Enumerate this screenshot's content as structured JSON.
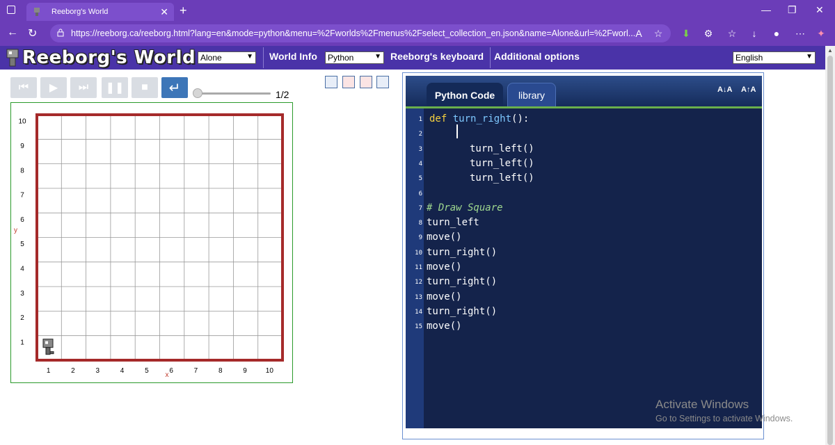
{
  "browser": {
    "tab_title": "Reeborg's World",
    "url": "https://reeborg.ca/reeborg.html?lang=en&mode=python&menu=%2Fworlds%2Fmenus%2Fselect_collection_en.json&name=Alone&url=%2Fworl..."
  },
  "header": {
    "logo_text": "Reeborg's World",
    "world_select": "Alone",
    "world_info": "World Info",
    "mode_select": "Python",
    "keyboard": "Reeborg's keyboard",
    "additional_options": "Additional options",
    "language_select": "English"
  },
  "controls": {
    "step_counter": "1/2"
  },
  "world": {
    "y_ticks": [
      "10",
      "9",
      "8",
      "7",
      "6",
      "5",
      "4",
      "3",
      "2",
      "1"
    ],
    "x_ticks": [
      "1",
      "2",
      "3",
      "4",
      "5",
      "6",
      "7",
      "8",
      "9",
      "10"
    ],
    "x_axis_label": "x",
    "y_axis_label": "y",
    "robot_position": {
      "x": 1,
      "y": 1
    },
    "wall_color": "#a52a2a",
    "border_color": "#2a9a2a"
  },
  "editor": {
    "tab_active": "Python Code",
    "tab_inactive": "library",
    "font_smaller": "A↓A",
    "font_larger": "A↑A",
    "lines": [
      {
        "n": "1",
        "text": "def turn_right():"
      },
      {
        "n": "2",
        "text": ""
      },
      {
        "n": "3",
        "text": "turn_left()"
      },
      {
        "n": "4",
        "text": "turn_left()"
      },
      {
        "n": "5",
        "text": "turn_left()"
      },
      {
        "n": "6",
        "text": ""
      },
      {
        "n": "7",
        "text": "# Draw Square"
      },
      {
        "n": "8",
        "text": "turn_left"
      },
      {
        "n": "9",
        "text": "move()"
      },
      {
        "n": "10",
        "text": "turn_right()"
      },
      {
        "n": "11",
        "text": "move()"
      },
      {
        "n": "12",
        "text": "turn_right()"
      },
      {
        "n": "13",
        "text": "move()"
      },
      {
        "n": "14",
        "text": "turn_right()"
      },
      {
        "n": "15",
        "text": "move()"
      }
    ]
  },
  "watermark": {
    "line1": "Activate Windows",
    "line2": "Go to Settings to activate Windows."
  }
}
